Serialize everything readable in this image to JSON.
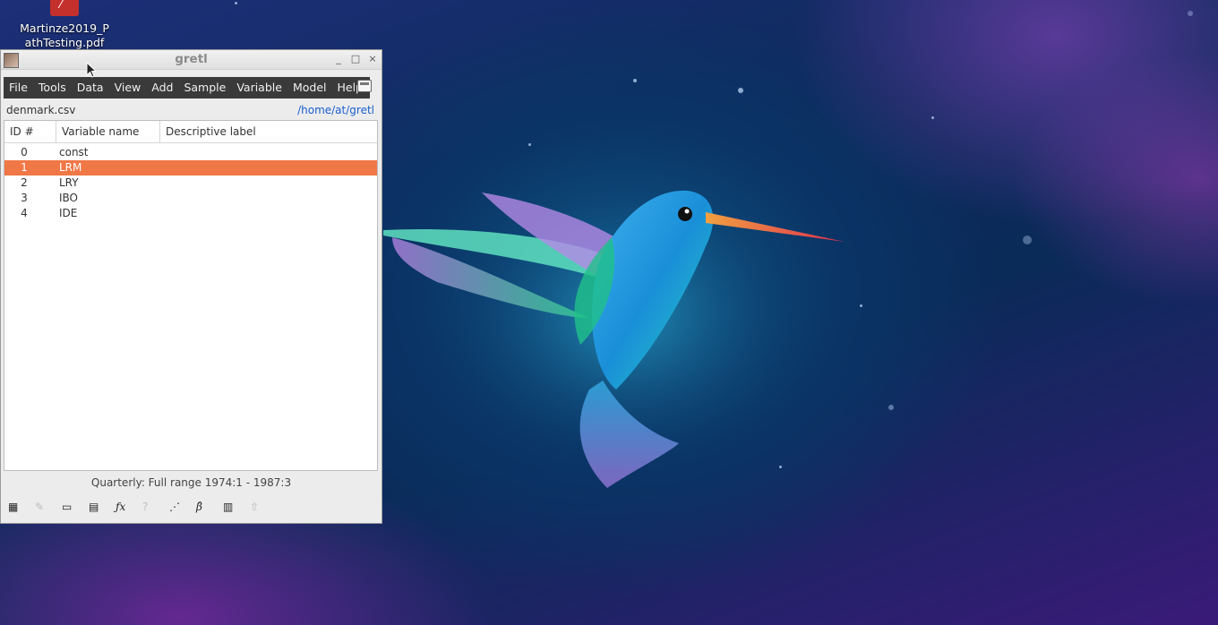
{
  "desktop": {
    "icon_label_line1": "Martinze2019_P",
    "icon_label_line2": "athTesting.pdf"
  },
  "window": {
    "title": "gretl",
    "minimize": "_",
    "maximize": "□",
    "close": "×"
  },
  "menu": {
    "items": [
      "File",
      "Tools",
      "Data",
      "View",
      "Add",
      "Sample",
      "Variable",
      "Model",
      "Help"
    ]
  },
  "info": {
    "filename": "denmark.csv",
    "path": "/home/at/gretl"
  },
  "table": {
    "headers": [
      "ID #",
      "Variable name",
      "Descriptive label"
    ],
    "rows": [
      {
        "id": "0",
        "name": "const",
        "label": "",
        "selected": false
      },
      {
        "id": "1",
        "name": "LRM",
        "label": "",
        "selected": true
      },
      {
        "id": "2",
        "name": "LRY",
        "label": "",
        "selected": false
      },
      {
        "id": "3",
        "name": "IBO",
        "label": "",
        "selected": false
      },
      {
        "id": "4",
        "name": "IDE",
        "label": "",
        "selected": false
      }
    ]
  },
  "status": {
    "text": "Quarterly: Full range 1974:1 - 1987:3"
  },
  "toolbar": {
    "items": [
      {
        "icon": "calculator-icon",
        "glyph": "▦",
        "enabled": true
      },
      {
        "icon": "pencil-icon",
        "glyph": "✎",
        "enabled": false
      },
      {
        "icon": "console-icon",
        "glyph": "▭",
        "enabled": true
      },
      {
        "icon": "session-icon",
        "glyph": "▤",
        "enabled": true
      },
      {
        "icon": "function-icon",
        "glyph": "ƒx",
        "enabled": true
      },
      {
        "icon": "help-icon",
        "glyph": "?",
        "enabled": false
      },
      {
        "icon": "scatter-plot-icon",
        "glyph": "⋰",
        "enabled": true
      },
      {
        "icon": "beta-hat-icon",
        "glyph": "β̂",
        "enabled": true
      },
      {
        "icon": "database-icon",
        "glyph": "▥",
        "enabled": true
      },
      {
        "icon": "upload-icon",
        "glyph": "⇧",
        "enabled": false
      }
    ]
  },
  "colors": {
    "selection": "#f07746",
    "menubar": "#3a3a3a",
    "path_link": "#1a5fd0"
  }
}
